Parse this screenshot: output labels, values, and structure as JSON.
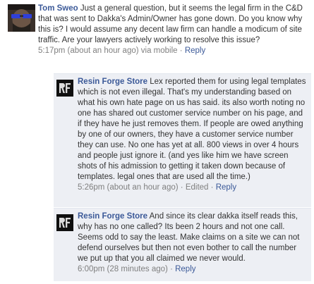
{
  "comments": [
    {
      "author": "Tom Sweo",
      "text": "Just a general question, but it seems the legal firm in the C&D that was sent to Dakka's Admin/Owner has gone down. Do you know why this is? I would assume any decent law firm can handle a modicum of site traffic. Are your lawyers actively working to resolve this issue?",
      "time": "5:17pm (about an hour ago)",
      "via": "via mobile",
      "reply_label": "Reply"
    },
    {
      "author": "Resin Forge Store",
      "text": "Lex reported them for using legal templates which is not even illegal. That's my understanding based on what his own hate page on us has said. its also worth noting no one has shared out customer service number on his page, and if they have he just removes them. If people are owed anything by one of our owners, they have a customer service number they can use. No one has yet at all. 800 views in over 4 hours and people just ignore it. (and yes like him we have screen shots of his admission to getting it taken down because of templates. legal ones that are used all the time.)",
      "time": "5:26pm (about an hour ago)",
      "edited": "Edited",
      "reply_label": "Reply"
    },
    {
      "author": "Resin Forge Store",
      "text": "And since its clear dakka itself reads this, why has no one called? Its been 2 hours and not one call. Seems odd to say the least. Make claims on a site we can not defend ourselves but then not even bother to call the number we put up that you all claimed we never would.",
      "time": "6:00pm (28 minutes ago)",
      "reply_label": "Reply"
    }
  ],
  "avatar_icons": [
    "profile-photo-icon",
    "resin-forge-logo-icon",
    "resin-forge-logo-icon"
  ],
  "colors": {
    "link": "#3b5998",
    "reply_bg": "#edeff4",
    "meta": "#7f7f7f",
    "text": "#333333"
  }
}
